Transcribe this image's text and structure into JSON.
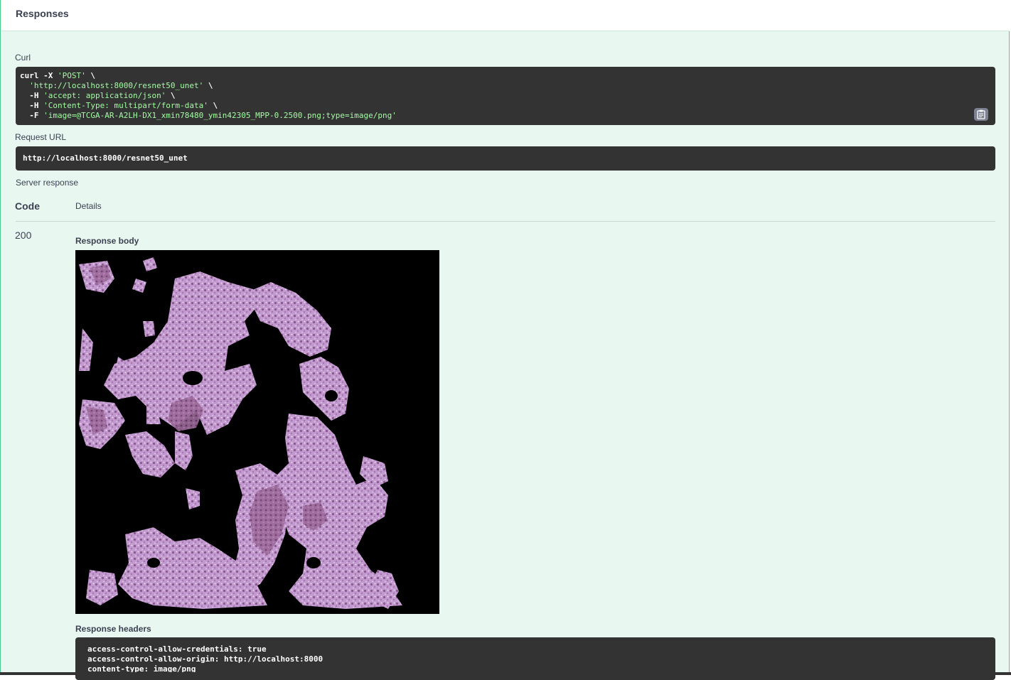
{
  "responses": {
    "title": "Responses"
  },
  "curl": {
    "label": "Curl",
    "lines": [
      {
        "cmd": "curl -X ",
        "str": "'POST'",
        "tail": " \\"
      },
      {
        "cmd": "  ",
        "str": "'http://localhost:8000/resnet50_unet'",
        "tail": " \\"
      },
      {
        "cmd": "  -H ",
        "str": "'accept: application/json'",
        "tail": " \\"
      },
      {
        "cmd": "  -H ",
        "str": "'Content-Type: multipart/form-data'",
        "tail": " \\"
      },
      {
        "cmd": "  -F ",
        "str": "'image=@TCGA-AR-A2LH-DX1_xmin78480_ymin42305_MPP-0.2500.png;type=image/png'",
        "tail": ""
      }
    ],
    "copy_icon": "clipboard-icon"
  },
  "request_url": {
    "label": "Request URL",
    "value": "http://localhost:8000/resnet50_unet"
  },
  "server_response": {
    "label": "Server response",
    "col_code": "Code",
    "col_details": "Details",
    "code": "200",
    "body_label": "Response body",
    "headers_label": "Response headers",
    "headers": [
      "access-control-allow-credentials: true",
      "access-control-allow-origin: http://localhost:8000",
      "content-type: image/png"
    ]
  },
  "colors": {
    "accent": "#49cc90",
    "background": "#e9f7f1",
    "code_bg": "#333333",
    "string": "#a2fca2"
  }
}
